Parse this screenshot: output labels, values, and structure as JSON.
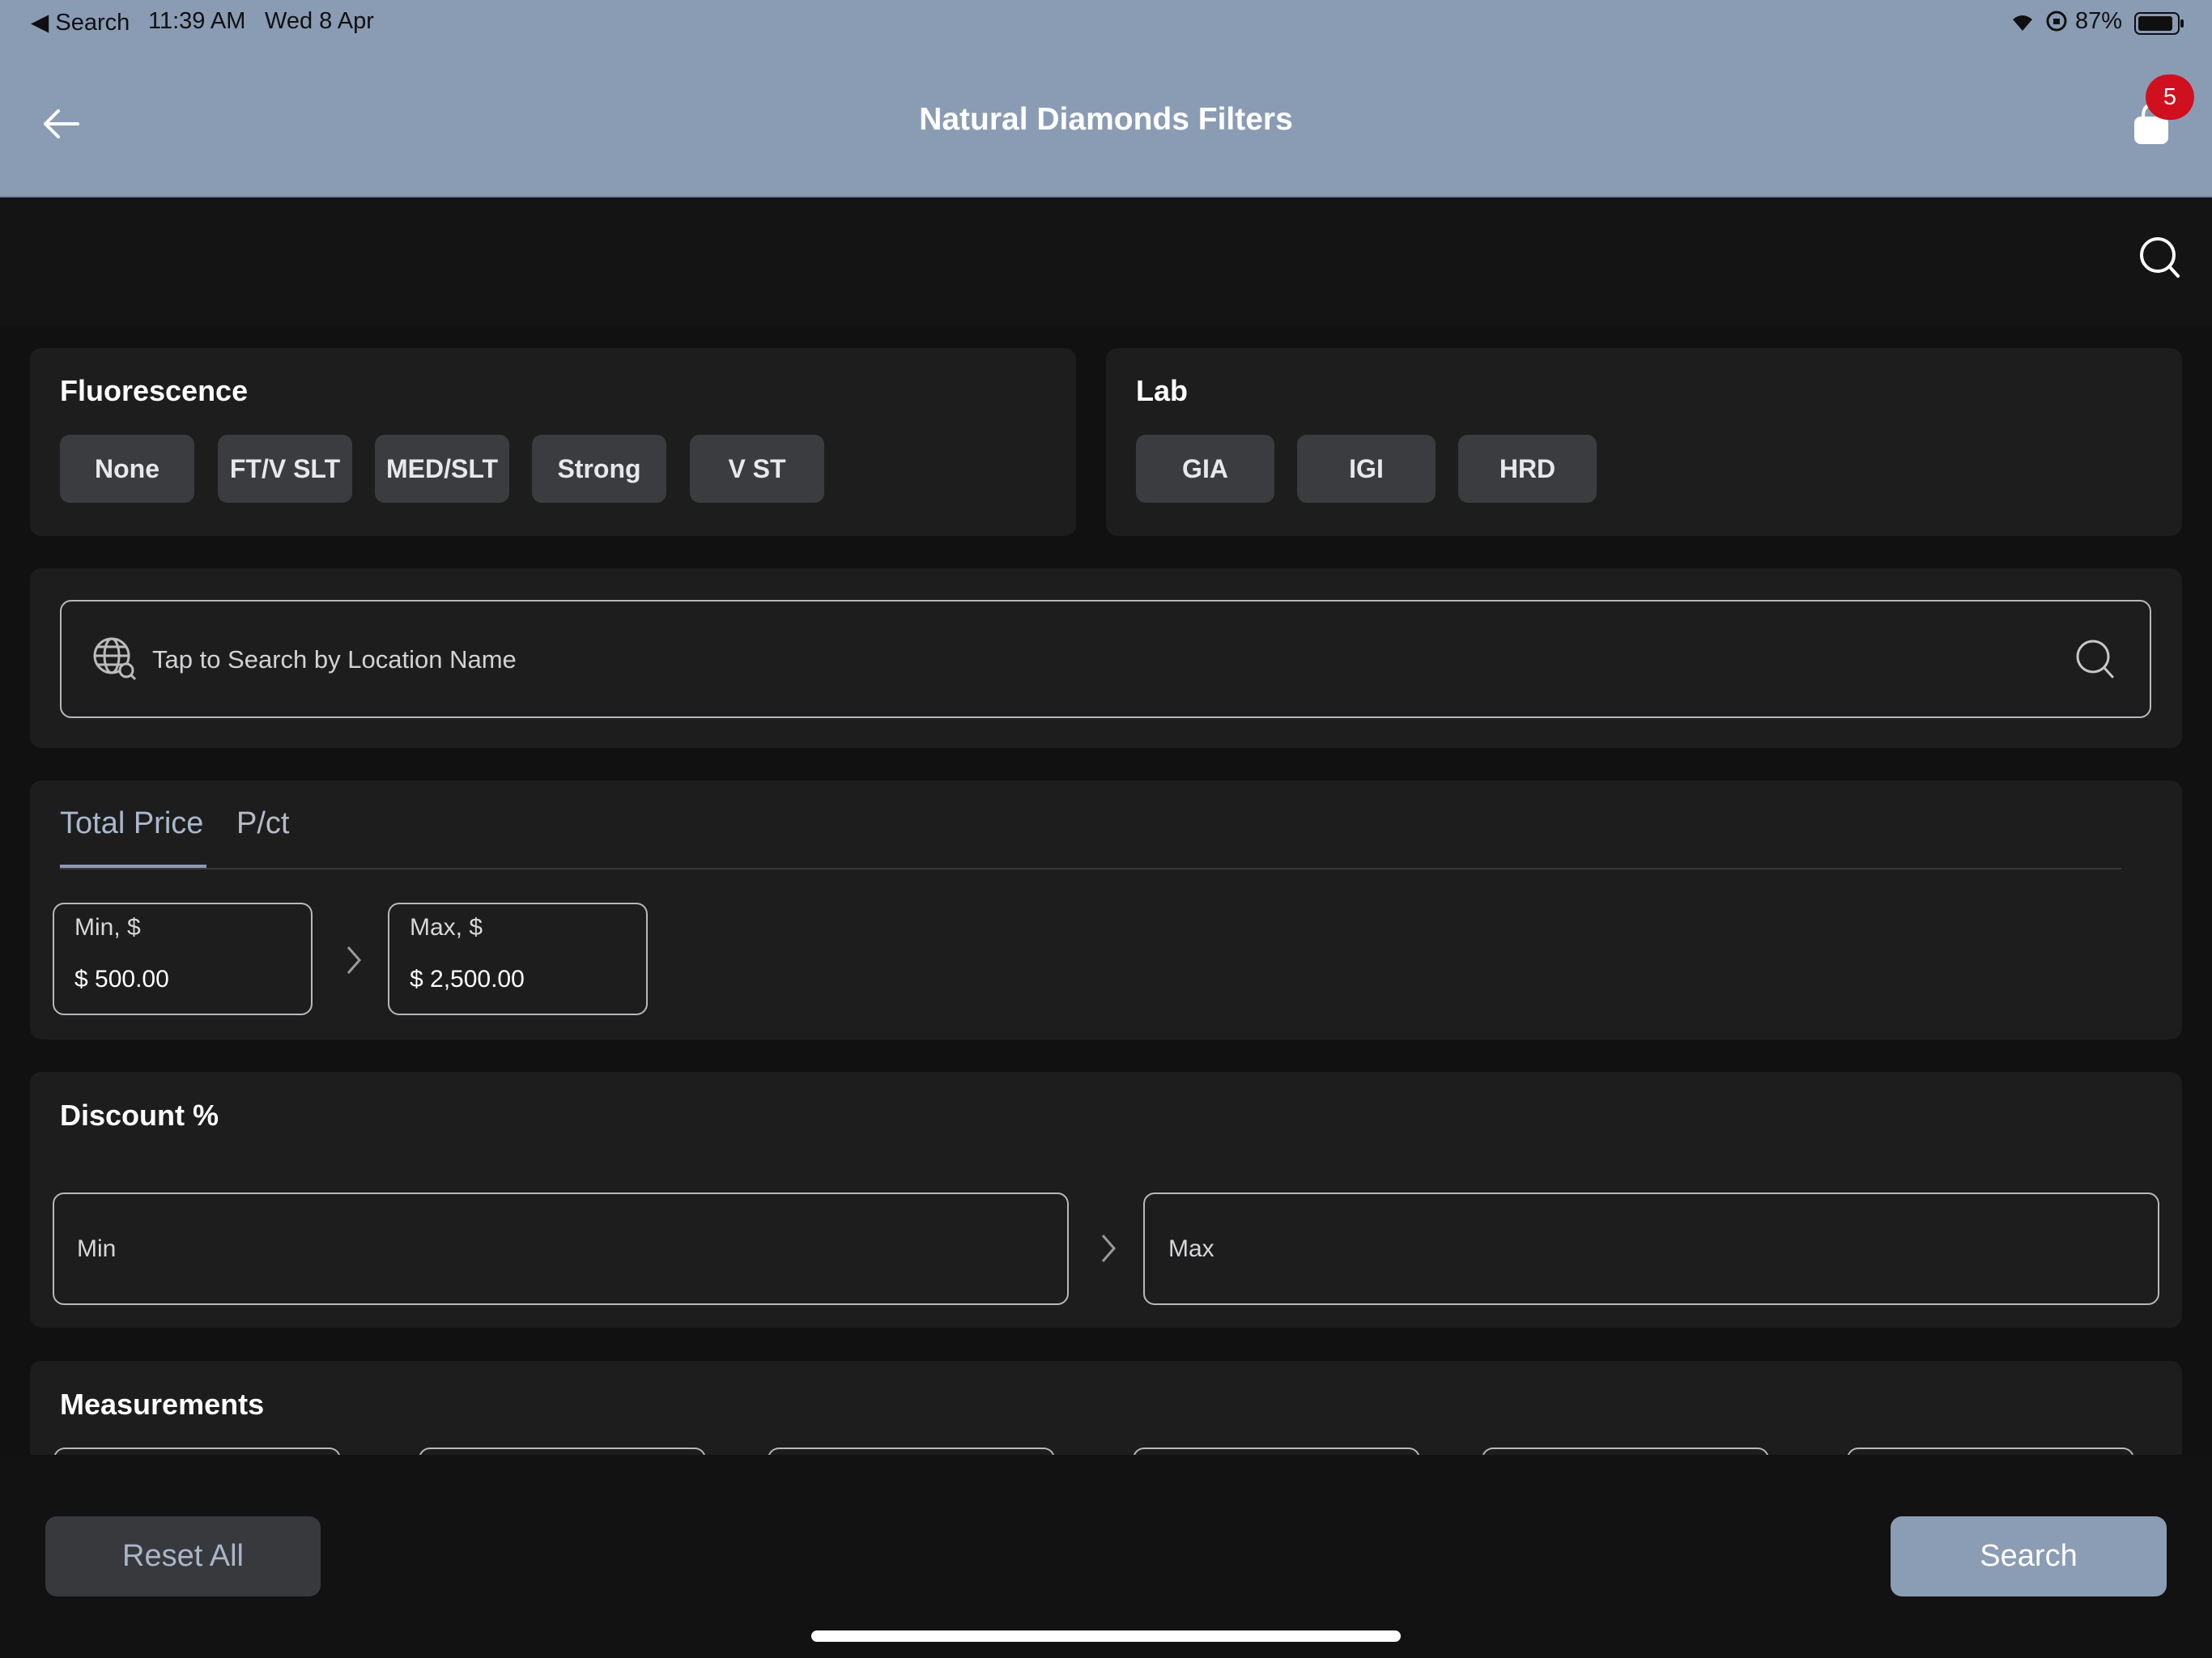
{
  "status_bar": {
    "back_app": "Search",
    "time": "11:39 AM",
    "date": "Wed 8 Apr",
    "battery": "87%"
  },
  "header": {
    "title": "Natural Diamonds Filters",
    "cart_count": "5"
  },
  "fluorescence": {
    "title": "Fluorescence",
    "options": [
      "None",
      "FT/V SLT",
      "MED/SLT",
      "Strong",
      "V ST"
    ]
  },
  "lab": {
    "title": "Lab",
    "options": [
      "GIA",
      "IGI",
      "HRD"
    ]
  },
  "location": {
    "placeholder": "Tap to Search by Location Name"
  },
  "price": {
    "tabs": [
      "Total Price",
      "P/ct"
    ],
    "active_tab": "Total Price",
    "min_label": "Min, $",
    "min_value": "$ 500.00",
    "max_label": "Max, $",
    "max_value": "$ 2,500.00"
  },
  "discount": {
    "title": "Discount %",
    "min_placeholder": "Min",
    "max_placeholder": "Max"
  },
  "measurements": {
    "title": "Measurements"
  },
  "footer": {
    "reset_label": "Reset All",
    "search_label": "Search"
  },
  "colors": {
    "header_bg": "#8a9cb4",
    "card_bg": "#1d1d1e",
    "chip_bg": "#3b3c40",
    "accent": "#8b9cb5",
    "badge": "#d0101f"
  },
  "icons": {
    "back": "arrow-left-icon",
    "cart": "shopping-bag-icon",
    "search": "search-icon",
    "globe": "globe-search-icon",
    "chevron": "chevron-right-icon"
  }
}
